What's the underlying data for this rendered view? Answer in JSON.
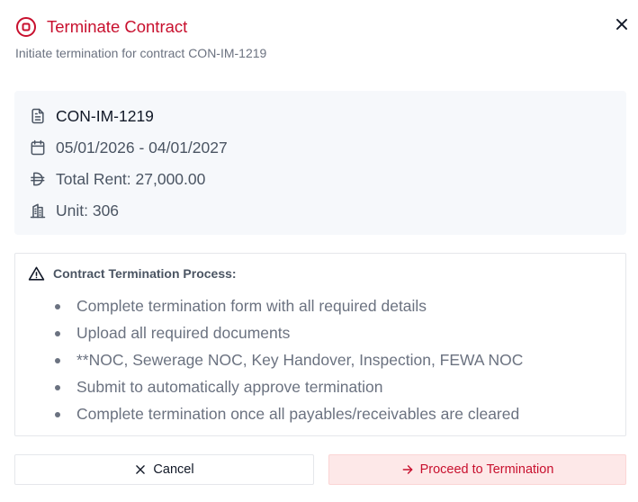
{
  "dialog": {
    "title": "Terminate Contract",
    "subtitle": "Initiate termination for contract CON-IM-1219",
    "accent_color": "#c8102e"
  },
  "contract": {
    "id": "CON-IM-1219",
    "period": "05/01/2026 - 04/01/2027",
    "total_rent": "Total Rent: 27,000.00",
    "unit": "Unit: 306",
    "icons": [
      "document-icon",
      "calendar-icon",
      "dirham-currency-icon",
      "building-icon"
    ]
  },
  "process": {
    "title": "Contract Termination Process:",
    "icon": "warning-icon",
    "steps": [
      "Complete termination form with all required details",
      "Upload all required documents",
      "**NOC, Sewerage NOC, Key Handover, Inspection, FEWA NOC",
      "Submit to automatically approve termination",
      "Complete termination once all payables/receivables are cleared"
    ]
  },
  "actions": {
    "cancel_label": "Cancel",
    "proceed_label": "Proceed to Termination"
  }
}
